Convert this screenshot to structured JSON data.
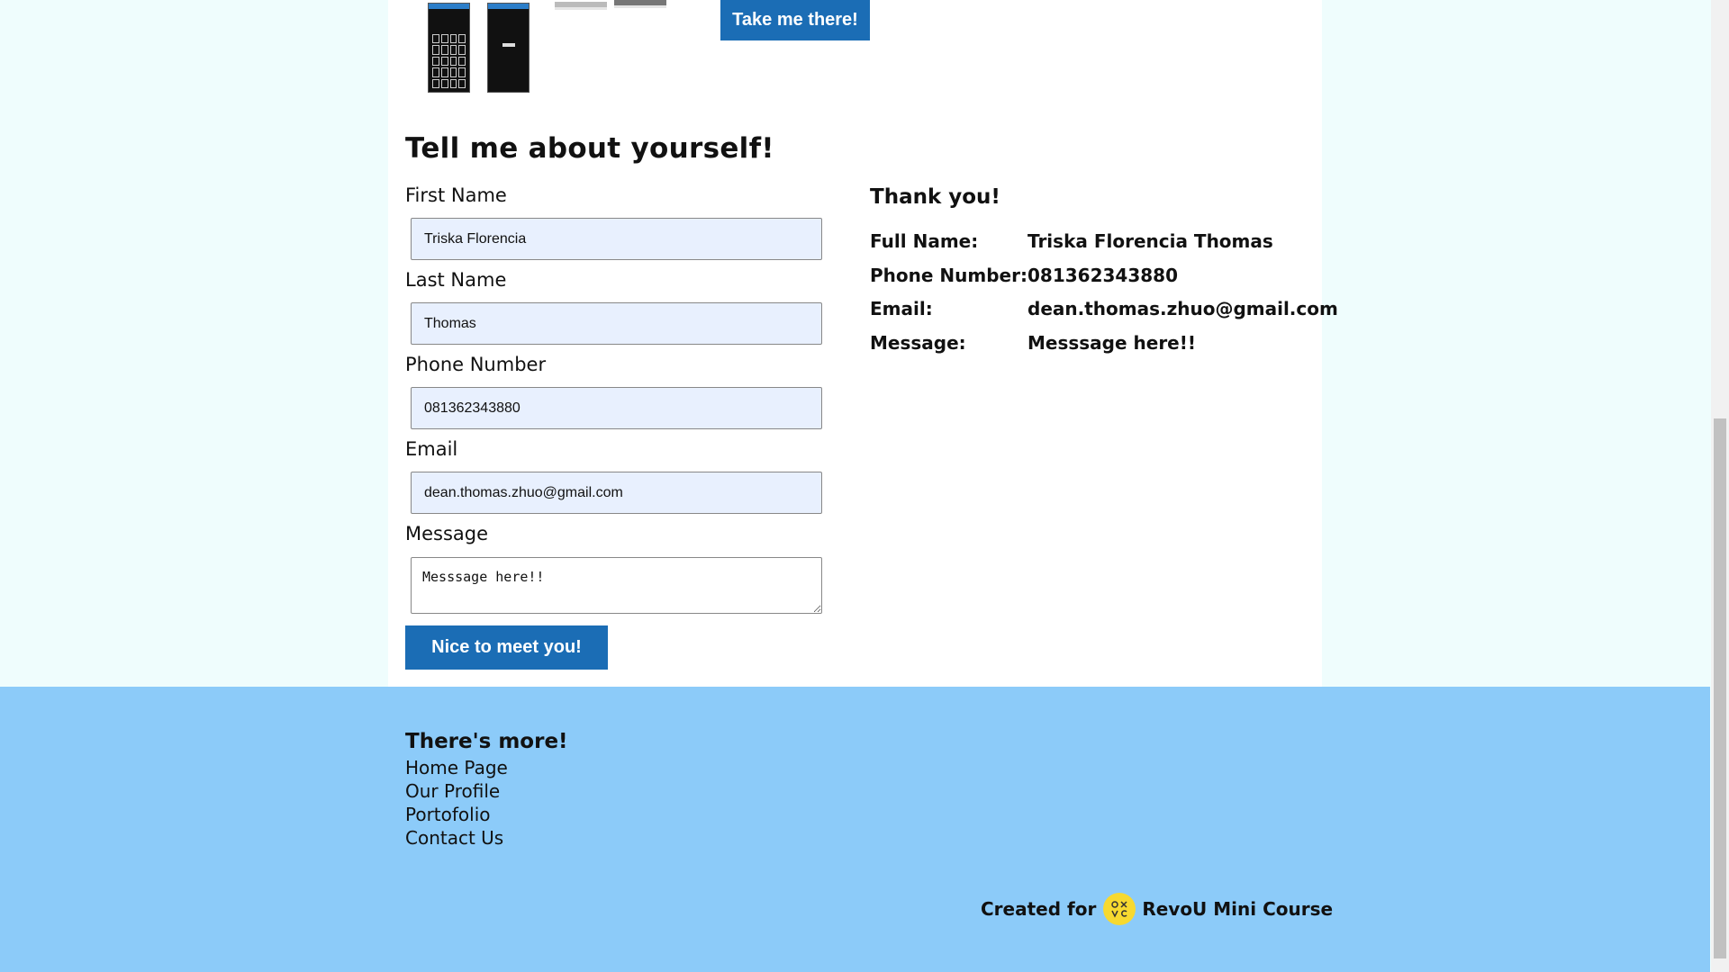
{
  "portfolio": {
    "cta_label": "Take me there!"
  },
  "form": {
    "title": "Tell me about yourself!",
    "first_name": {
      "label": "First Name",
      "value": "Triska Florencia"
    },
    "last_name": {
      "label": "Last Name",
      "value": "Thomas"
    },
    "phone": {
      "label": "Phone Number",
      "value": "081362343880"
    },
    "email": {
      "label": "Email",
      "value": "dean.thomas.zhuo@gmail.com"
    },
    "message": {
      "label": "Message",
      "value": "Messsage here!!"
    },
    "submit_label": "Nice to meet you!"
  },
  "result": {
    "title": "Thank you!",
    "rows": [
      {
        "key": "Full Name:",
        "value": "Triska Florencia Thomas"
      },
      {
        "key": "Phone Number:",
        "value": "081362343880"
      },
      {
        "key": "Email:",
        "value": "dean.thomas.zhuo@gmail.com"
      },
      {
        "key": "Message:",
        "value": "Messsage here!!"
      }
    ]
  },
  "footer": {
    "title": "There's more!",
    "links": [
      "Home Page",
      "Our Profile",
      "Portofolio",
      "Contact Us"
    ],
    "credit_prefix": "Created for",
    "credit_suffix": "RevoU Mini Course"
  },
  "colors": {
    "accent": "#1b6db5",
    "footer_bg": "#8ccbf9",
    "page_bg": "#effdfd",
    "logo": "#f7d930"
  }
}
